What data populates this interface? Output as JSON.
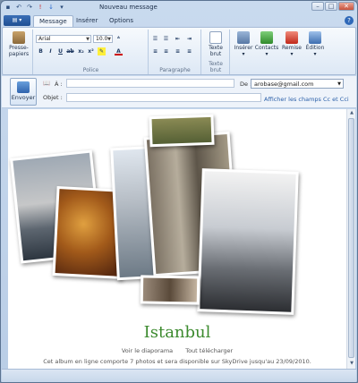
{
  "window": {
    "title": "Nouveau message"
  },
  "tabs": [
    {
      "label": "Message"
    },
    {
      "label": "Insérer"
    },
    {
      "label": "Options"
    }
  ],
  "ribbon": {
    "presse_papiers": "Presse-papiers",
    "font_name": "Arial",
    "font_size": "10.0",
    "groups": {
      "police": "Police",
      "paragraphe": "Paragraphe",
      "texte_brut": "Texte brut"
    },
    "texte_brut_btn": "Texte brut",
    "inserer": "Insérer",
    "contacts": "Contacts",
    "remise": "Remise",
    "edition": "Édition"
  },
  "fields": {
    "send_label": "Envoyer",
    "to_label": "À :",
    "subject_label": "Objet :",
    "from_label": "De :",
    "from_value": "arobase@gmail.com",
    "cc_link": "Afficher les champs Cc et Cci"
  },
  "album": {
    "title": "Istanbul",
    "link_slideshow": "Voir le diaporama",
    "link_download": "Tout télécharger",
    "note": "Cet album en ligne comporte 7 photos et sera disponible sur SkyDrive jusqu'au 23/09/2010."
  },
  "colors": {
    "accent": "#3c8a2e",
    "link": "#2a5fa8",
    "ribbon": "#dde8f5"
  }
}
